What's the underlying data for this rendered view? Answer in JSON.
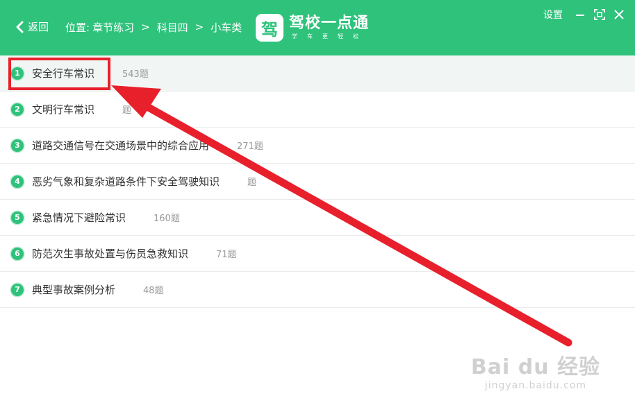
{
  "header": {
    "back_label": "返回",
    "location_label": "位置:",
    "breadcrumb": [
      "章节练习",
      "科目四",
      "小车类"
    ],
    "separator": ">",
    "logo_mark": "驾",
    "app_name": "驾校一点通",
    "app_slogan": "学车更轻松",
    "settings_label": "设置",
    "background_color": "#2ec27b"
  },
  "chapters": [
    {
      "index": "1",
      "title": "安全行车常识",
      "count": "543题"
    },
    {
      "index": "2",
      "title": "文明行车常识",
      "count": "题"
    },
    {
      "index": "3",
      "title": "道路交通信号在交通场景中的综合应用",
      "count": "271题"
    },
    {
      "index": "4",
      "title": "恶劣气象和复杂道路条件下安全驾驶知识",
      "count": "题"
    },
    {
      "index": "5",
      "title": "紧急情况下避险常识",
      "count": "160题"
    },
    {
      "index": "6",
      "title": "防范次生事故处置与伤员急救知识",
      "count": "71题"
    },
    {
      "index": "7",
      "title": "典型事故案例分析",
      "count": "48题"
    }
  ],
  "annotation": {
    "color": "#e8202b"
  },
  "watermark": {
    "main": "Bai du 经验",
    "sub": "jingyan.baidu.com"
  }
}
